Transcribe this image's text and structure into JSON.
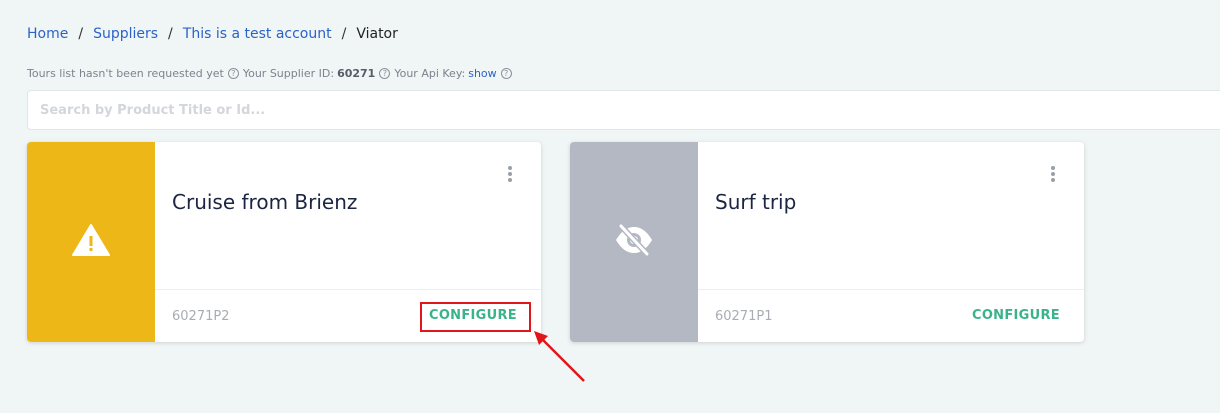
{
  "breadcrumb": {
    "home": "Home",
    "suppliers": "Suppliers",
    "account": "This is a test account",
    "current": "Viator",
    "separator": "/"
  },
  "info": {
    "tours_status": "Tours list hasn't been requested yet",
    "supplier_id_label": "Your Supplier ID:",
    "supplier_id": "60271",
    "api_key_label": "Your Api Key:",
    "api_key_link": "show",
    "help_glyph": "?"
  },
  "search": {
    "placeholder": "Search by Product Title or Id..."
  },
  "cards": [
    {
      "title": "Cruise from Brienz",
      "code": "60271P2",
      "action": "CONFIGURE",
      "status_icon": "warning-icon",
      "side_color": "#eeb718"
    },
    {
      "title": "Surf trip",
      "code": "60271P1",
      "action": "CONFIGURE",
      "status_icon": "eye-off-icon",
      "side_color": "#b4b8c3"
    }
  ],
  "colors": {
    "accent": "#3bb38a",
    "link": "#2b62c9",
    "annotation": "#e0161b"
  }
}
